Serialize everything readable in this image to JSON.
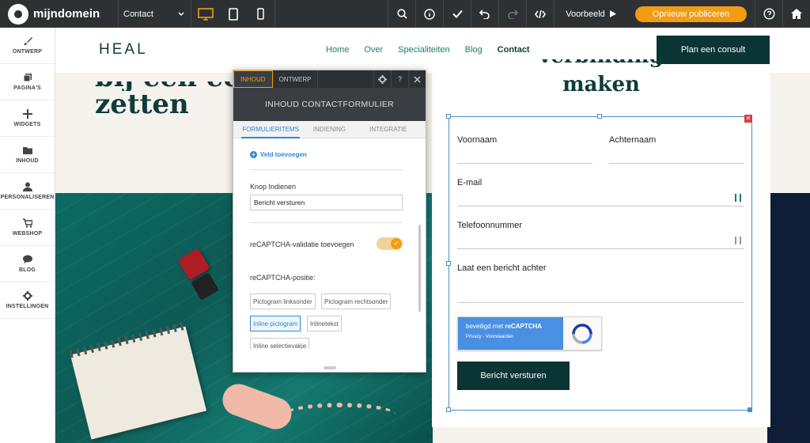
{
  "topbar": {
    "brand": "mijndomein",
    "page_select": "Contact",
    "preview_label": "Voorbeeld",
    "publish_label": "Opnieuw publiceren"
  },
  "sidebar": {
    "items": [
      {
        "label": "ONTWERP",
        "icon": "brush-icon"
      },
      {
        "label": "PAGINA'S",
        "icon": "pages-icon"
      },
      {
        "label": "WIDGETS",
        "icon": "plus-icon"
      },
      {
        "label": "INHOUD",
        "icon": "folder-icon"
      },
      {
        "label": "PERSONALISEREN",
        "icon": "person-icon"
      },
      {
        "label": "WEBSHOP",
        "icon": "cart-icon"
      },
      {
        "label": "BLOG",
        "icon": "chat-icon"
      },
      {
        "label": "INSTELLINGEN",
        "icon": "gear-icon"
      }
    ]
  },
  "site": {
    "logo": "HEAL",
    "nav": [
      "Home",
      "Over",
      "Specialiteiten",
      "Blog",
      "Contact"
    ],
    "nav_current": "Contact",
    "cta": "Plan een consult",
    "hero_partial": "bij een eerste",
    "hero_line": "zetten",
    "form_title_partial": "verbinding",
    "form_title": "maken"
  },
  "form": {
    "first_name": "Voornaam",
    "last_name": "Achternaam",
    "email": "E-mail",
    "phone": "Telefoonnummer",
    "message": "Laat een bericht achter",
    "recaptcha_line1_prefix": "beveiligd met ",
    "recaptcha_line1_brand": "reCAPTCHA",
    "recaptcha_line2": "Privacy - Voorwaarden",
    "submit": "Bericht versturen"
  },
  "panel": {
    "tab_content": "INHOUD",
    "tab_design": "ONTWERP",
    "help": "?",
    "title": "INHOUD CONTACTFORMULIER",
    "subtabs": [
      "FORMULIERITEMS",
      "INDIENING",
      "INTEGRATIE"
    ],
    "add_field": "Veld toevoegen",
    "submit_label": "Knop Indienen",
    "submit_value": "Bericht versturen",
    "recaptcha_toggle_label": "reCAPTCHA-validatie toevoegen",
    "recaptcha_enabled": true,
    "recaptcha_position_label": "reCAPTCHA-positie:",
    "position_options": [
      "Pictogram linksonder",
      "Pictogram rechtsonder",
      "Inline pictogram",
      "Inlinetekst",
      "Inline selectievakje"
    ],
    "position_selected": "Inline pictogram"
  },
  "colors": {
    "topbar": "#2d3134",
    "accent": "#f39c12",
    "brand_dark": "#0b3434",
    "link_blue": "#2f89d6"
  }
}
